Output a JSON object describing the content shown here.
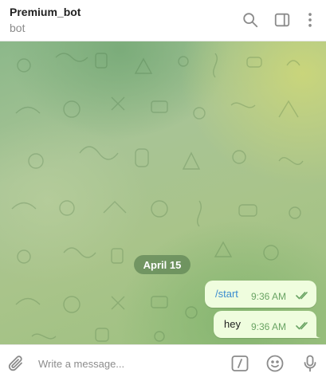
{
  "header": {
    "title": "Premium_bot",
    "subtitle": "bot",
    "icons": [
      "search-icon",
      "sidebar-toggle-icon",
      "more-vertical-icon"
    ]
  },
  "chat": {
    "date_label": "April 15",
    "messages": [
      {
        "text": "/start",
        "time": "9:36 AM",
        "status": "read",
        "is_command": true
      },
      {
        "text": "hey",
        "time": "9:36 AM",
        "status": "read",
        "is_command": false
      }
    ]
  },
  "composer": {
    "placeholder": "Write a message...",
    "icons": [
      "attach-icon",
      "bot-commands-icon",
      "emoji-icon",
      "microphone-icon"
    ]
  },
  "colors": {
    "accent": "#3b8ccf",
    "outgoing_bubble": "#effdde",
    "time_text": "#6aa464",
    "icon_gray": "#8b8b8b"
  }
}
